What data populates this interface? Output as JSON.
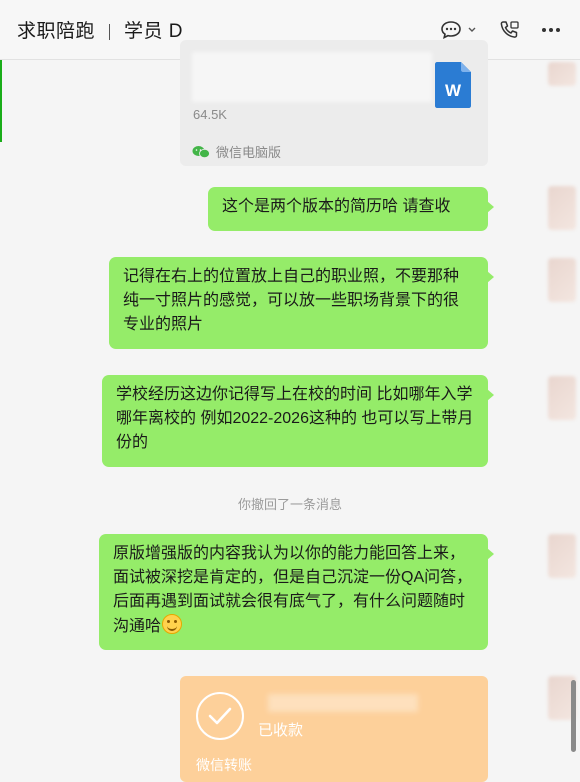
{
  "header": {
    "chat_name": "求职陪跑",
    "member_name": "学员 D"
  },
  "file_message": {
    "size": "64.5K",
    "source": "微信电脑版",
    "icon_letter": "W",
    "icon_color": "#2b7cd3"
  },
  "messages": [
    {
      "text": "这个是两个版本的简历哈 请查收"
    },
    {
      "text": "记得在右上的位置放上自己的职业照，不要那种纯一寸照片的感觉，可以放一些职场背景下的很专业的照片"
    },
    {
      "text": "学校经历这边你记得写上在校的时间 比如哪年入学哪年离校的 例如2022-2026这种的 也可以写上带月份的"
    },
    {
      "text": "原版增强版的内容我认为以你的能力能回答上来，面试被深挖是肯定的，但是自己沉淀一份QA问答，后面再遇到面试就会很有底气了，有什么问题随时沟通哈"
    }
  ],
  "recall_notice": "你撤回了一条消息",
  "transfer": {
    "status": "已收款",
    "label": "微信转账",
    "color": "#fdd09a"
  },
  "colors": {
    "bubble": "#95ec69",
    "accent": "#1aad19"
  }
}
